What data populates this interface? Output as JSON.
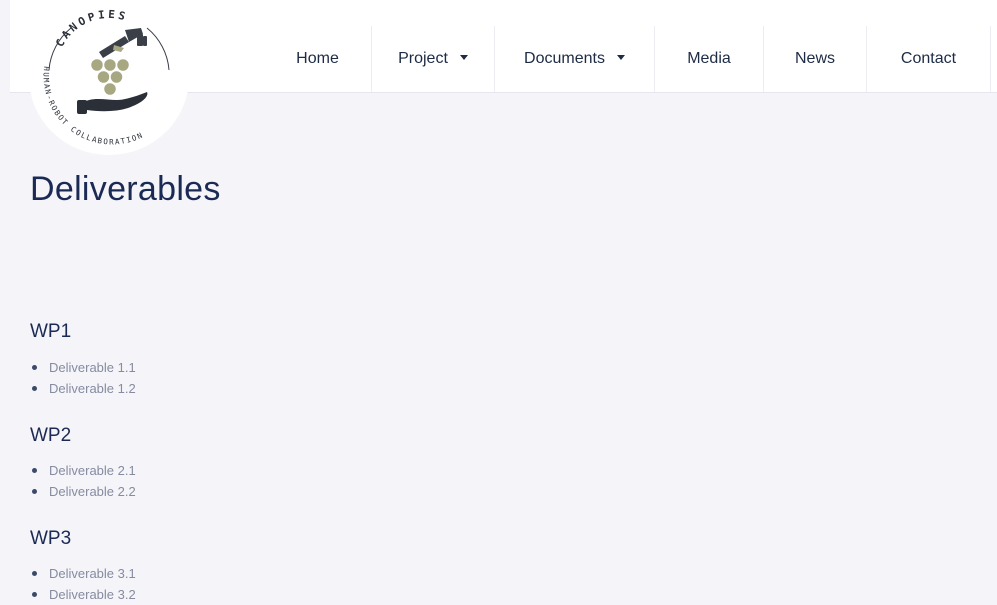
{
  "logo": {
    "top_text": "CANOPIES",
    "ring_text": "HUMAN-ROBOT COLLABORATION",
    "colors": {
      "grapes": "#a7a882",
      "hand": "#2b3038",
      "robot": "#3a3f48"
    }
  },
  "nav": {
    "items": [
      {
        "label": "Home",
        "has_dropdown": false
      },
      {
        "label": "Project",
        "has_dropdown": true
      },
      {
        "label": "Documents",
        "has_dropdown": true
      },
      {
        "label": "Media",
        "has_dropdown": false
      },
      {
        "label": "News",
        "has_dropdown": false
      },
      {
        "label": "Contact",
        "has_dropdown": false
      }
    ]
  },
  "page": {
    "title": "Deliverables"
  },
  "workpackages": [
    {
      "title": "WP1",
      "deliverables": [
        "Deliverable 1.1",
        "Deliverable 1.2"
      ]
    },
    {
      "title": "WP2",
      "deliverables": [
        "Deliverable 2.1",
        "Deliverable 2.2"
      ]
    },
    {
      "title": "WP3",
      "deliverables": [
        "Deliverable 3.1",
        "Deliverable 3.2"
      ]
    }
  ],
  "colors": {
    "background": "#f5f5f9",
    "heading": "#1b2a55",
    "nav_text": "#1d2b45",
    "list_text": "#858ba0"
  }
}
